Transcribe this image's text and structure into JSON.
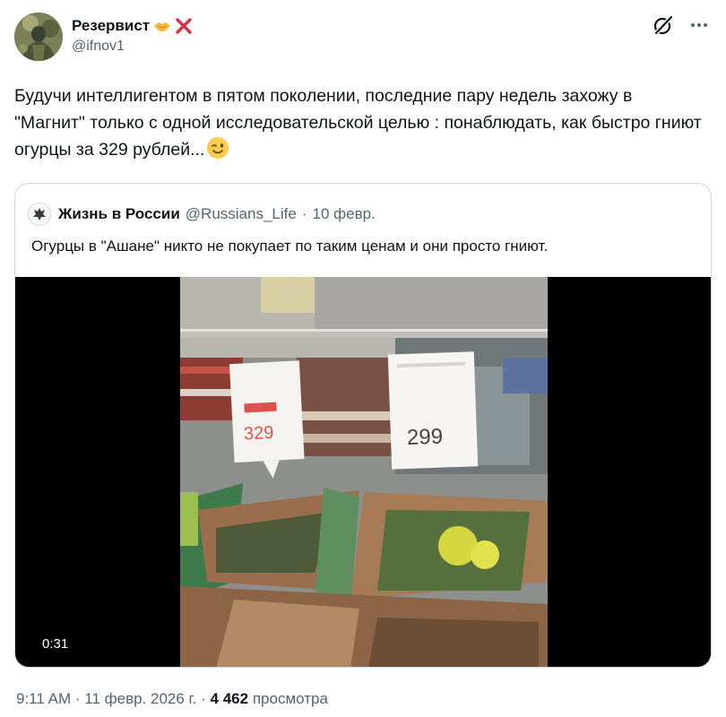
{
  "tweet": {
    "display_name": "Резервист",
    "name_emojis": [
      "handshake-emoji",
      "cross-mark-emoji"
    ],
    "handle": "@ifnov1",
    "text": "Будучи интеллигентом в пятом поколении, последние пару недель захожу в \"Магнит\" только с одной исследовательской целью : понаблюдать, как быстро гниют огурцы за 329 рублей...",
    "text_emoji": "wink-emoji"
  },
  "quote": {
    "display_name": "Жизнь в России",
    "handle": "@Russians_Life",
    "separator": "·",
    "date": "10 февр.",
    "text": "Огурцы в \"Ашане\" никто не покупает по таким ценам и они просто гниют.",
    "video": {
      "duration": "0:31",
      "price_tag_left": "329",
      "price_tag_right": "299"
    }
  },
  "footer": {
    "time": "9:11 AM",
    "sep1": "·",
    "date": "11 февр. 2026 г.",
    "sep2": "·",
    "views": "4 462",
    "views_label": "просмотра"
  }
}
